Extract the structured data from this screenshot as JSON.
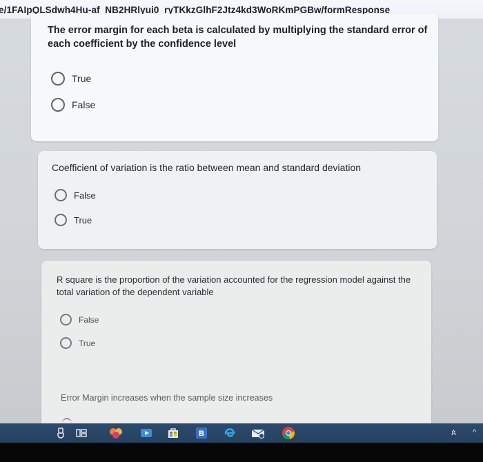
{
  "browser": {
    "url_fragment": "e/1FAIpQLSdwh4Hu-af_NB2HRlyui0_ryTKkzGlhF2Jtz4kd3WoRKmPGBw/formResponse"
  },
  "questions": [
    {
      "text": "The error margin for each beta is calculated by multiplying the standard error of each coefficient by the confidence level",
      "options": [
        "True",
        "False"
      ]
    },
    {
      "text": "Coefficient of variation is the ratio between mean and standard deviation",
      "options": [
        "False",
        "True"
      ]
    },
    {
      "text": "R square is the proportion of the variation accounted for the regression model against the total variation of the dependent variable",
      "options": [
        "False",
        "True"
      ]
    },
    {
      "text": "Error Margin increases when the sample size increases",
      "options": []
    }
  ],
  "colors": {
    "page_bg": "#d3d7db",
    "card_bg": "#f6f7f8",
    "radio_border": "#5f6368",
    "text": "#202124",
    "taskbar": "#2a4668"
  },
  "taskbar": {
    "items": [
      {
        "icon": "usb-icon"
      },
      {
        "icon": "task-view-icon"
      },
      {
        "icon": "blossom-app-icon"
      },
      {
        "icon": "media-player-icon"
      },
      {
        "icon": "store-icon"
      },
      {
        "icon": "bing-icon",
        "label": "B"
      },
      {
        "icon": "edge-icon"
      },
      {
        "icon": "mail-icon"
      },
      {
        "icon": "chrome-icon"
      }
    ],
    "tray": {
      "people_icon": "people-icon",
      "chevron_icon": "chevron-up-icon"
    }
  }
}
